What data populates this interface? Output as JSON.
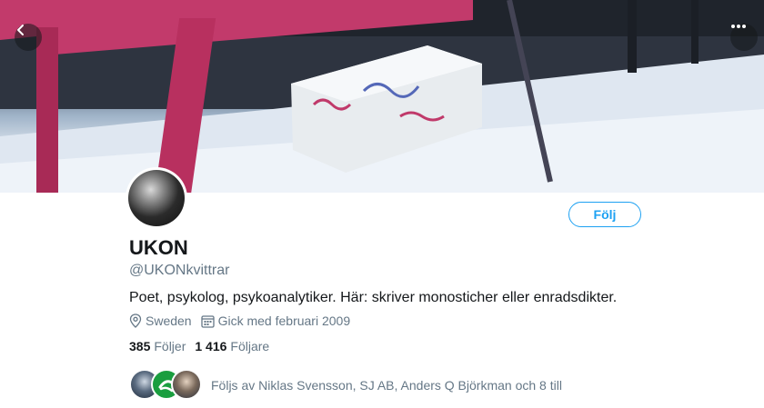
{
  "header": {
    "back_icon": "chevron-left-icon",
    "more_icon": "more-horizontal-icon"
  },
  "profile": {
    "name": "UKON",
    "handle": "@UKONkvittrar",
    "bio": "Poet, psykolog, psykoanalytiker. Här: skriver monosticher eller enradsdikter.",
    "location": "Sweden",
    "joined": "Gick med februari 2009",
    "following_count": "385",
    "following_label": "Följer",
    "followers_count": "1 416",
    "followers_label": "Följare",
    "followed_by": "Följs av Niklas Svensson, SJ AB, Anders Q Björkman och 8 till"
  },
  "actions": {
    "follow_label": "Följ"
  },
  "colors": {
    "accent": "#1da1f2",
    "secondary_text": "#657786",
    "primary_text": "#14171a"
  }
}
